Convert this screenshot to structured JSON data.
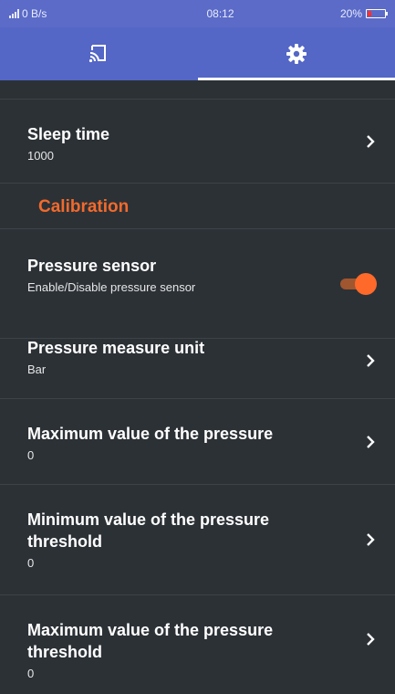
{
  "status_bar": {
    "network_speed": "0 B/s",
    "time": "08:12",
    "battery_percent": "20%",
    "battery_level": 0.2
  },
  "tabs": [
    {
      "icon": "cast-icon",
      "active": false
    },
    {
      "icon": "gear-icon",
      "active": true
    }
  ],
  "settings": {
    "sleep_time": {
      "title": "Sleep time",
      "value": "1000"
    },
    "section": {
      "title": "Calibration"
    },
    "pressure_sensor": {
      "title": "Pressure sensor",
      "summary": "Enable/Disable pressure sensor",
      "enabled": true
    },
    "pressure_unit": {
      "title": "Pressure measure unit",
      "value": "Bar"
    },
    "max_pressure": {
      "title": "Maximum value of the pressure",
      "value": "0"
    },
    "min_threshold": {
      "title": "Minimum value of the pressure threshold",
      "value": "0"
    },
    "max_threshold": {
      "title": "Maximum value of the pressure threshold",
      "value": "0"
    }
  },
  "colors": {
    "accent": "#f26a2c",
    "header": "#5466c6",
    "background": "#2c3136"
  }
}
